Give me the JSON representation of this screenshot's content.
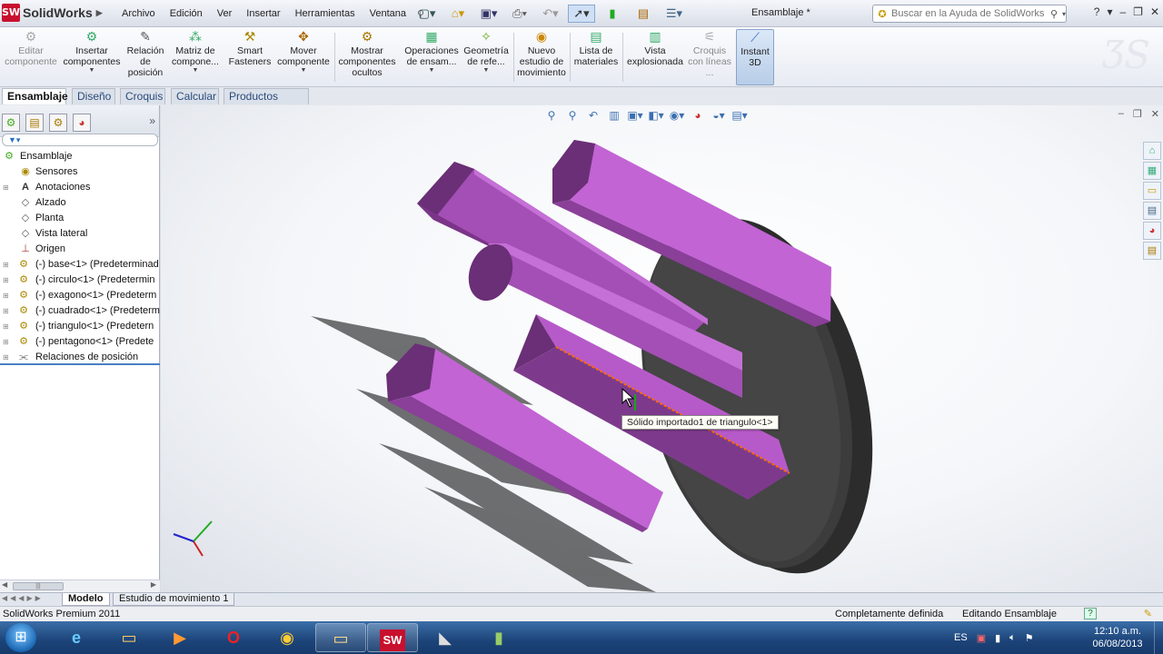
{
  "app": {
    "logo": "SolidWorks",
    "document_title": "Ensamblaje *"
  },
  "menu": [
    "Archivo",
    "Edición",
    "Ver",
    "Insertar",
    "Herramientas",
    "Ventana"
  ],
  "search": {
    "placeholder": "Buscar en la Ayuda de SolidWorks"
  },
  "commands": {
    "editar": "Editar componente",
    "insertar": "Insertar componentes",
    "relacion": "Relación de posición",
    "matriz": "Matriz de compone...",
    "smart": "Smart Fasteners",
    "mover": "Mover componente",
    "mostrar": "Mostrar componentes ocultos",
    "operaciones": "Operaciones de ensam...",
    "geometria": "Geometría de refe...",
    "nuevo": "Nuevo estudio de movimiento",
    "lista": "Lista de materiales",
    "vista": "Vista explosionada",
    "croquis": "Croquis con líneas ...",
    "instant": "Instant 3D"
  },
  "tabs": [
    "Ensamblaje",
    "Diseño",
    "Croquis",
    "Calcular",
    "Productos Office"
  ],
  "tree": {
    "root": "Ensamblaje",
    "items": [
      {
        "label": "Sensores",
        "icon": "sensor-icon"
      },
      {
        "label": "Anotaciones",
        "icon": "annotation-icon"
      },
      {
        "label": "Alzado",
        "icon": "plane-icon"
      },
      {
        "label": "Planta",
        "icon": "plane-icon"
      },
      {
        "label": "Vista lateral",
        "icon": "plane-icon"
      },
      {
        "label": "Origen",
        "icon": "origin-icon"
      },
      {
        "label": "(-) base<1> (Predeterminad",
        "icon": "part-icon"
      },
      {
        "label": "(-) circulo<1> (Predetermin",
        "icon": "part-icon"
      },
      {
        "label": "(-) exagono<1> (Predeterm",
        "icon": "part-icon"
      },
      {
        "label": "(-) cuadrado<1> (Predeterm",
        "icon": "part-icon"
      },
      {
        "label": "(-) triangulo<1> (Predetern",
        "icon": "part-icon"
      },
      {
        "label": "(-) pentagono<1> (Predete",
        "icon": "part-icon"
      },
      {
        "label": "Relaciones de posición",
        "icon": "mates-icon"
      }
    ]
  },
  "tooltip": "Sólido importado1 de triangulo<1>",
  "bottom_tabs": [
    "Modelo",
    "Estudio de movimiento 1"
  ],
  "status": {
    "product": "SolidWorks Premium 2011",
    "definition": "Completamente definida",
    "editing": "Editando Ensamblaje"
  },
  "taskbar": {
    "language": "ES",
    "time": "12:10 a.m.",
    "date": "06/08/2013"
  },
  "colors": {
    "part_purple": "#b45cc8",
    "part_dark": "#6a2f76",
    "base_disk": "#3c3c3c"
  }
}
